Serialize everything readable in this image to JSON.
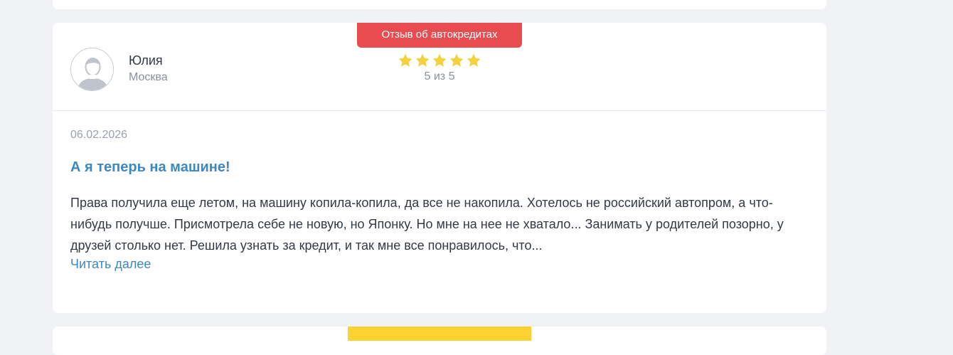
{
  "review": {
    "badge": "Отзыв об автокредитах",
    "author": {
      "name": "Юлия",
      "city": "Москва",
      "avatar_icon": "user-silhouette-icon"
    },
    "rating": {
      "value": 5,
      "max": 5,
      "text": "5 из 5",
      "star_color": "#f5d13d"
    },
    "date": "06.02.2026",
    "title": "А я теперь на машине!",
    "body": "Права получила еще летом, на машину копила-копила, да все не накопила. Хотелось не российский автопром, а что-нибудь получше. Присмотрела себе не новую, но Японку. Но мне на нее не хватало... Занимать у родителей позорно, у друзей столько нет. Решила узнать за кредит, и так мне все понравилось, что...",
    "read_more": "Читать далее"
  },
  "colors": {
    "badge_red": "#e84c4f",
    "badge_yellow": "#fcd232",
    "link_blue": "#3d88c0",
    "page_bg": "#f0f2f5"
  }
}
